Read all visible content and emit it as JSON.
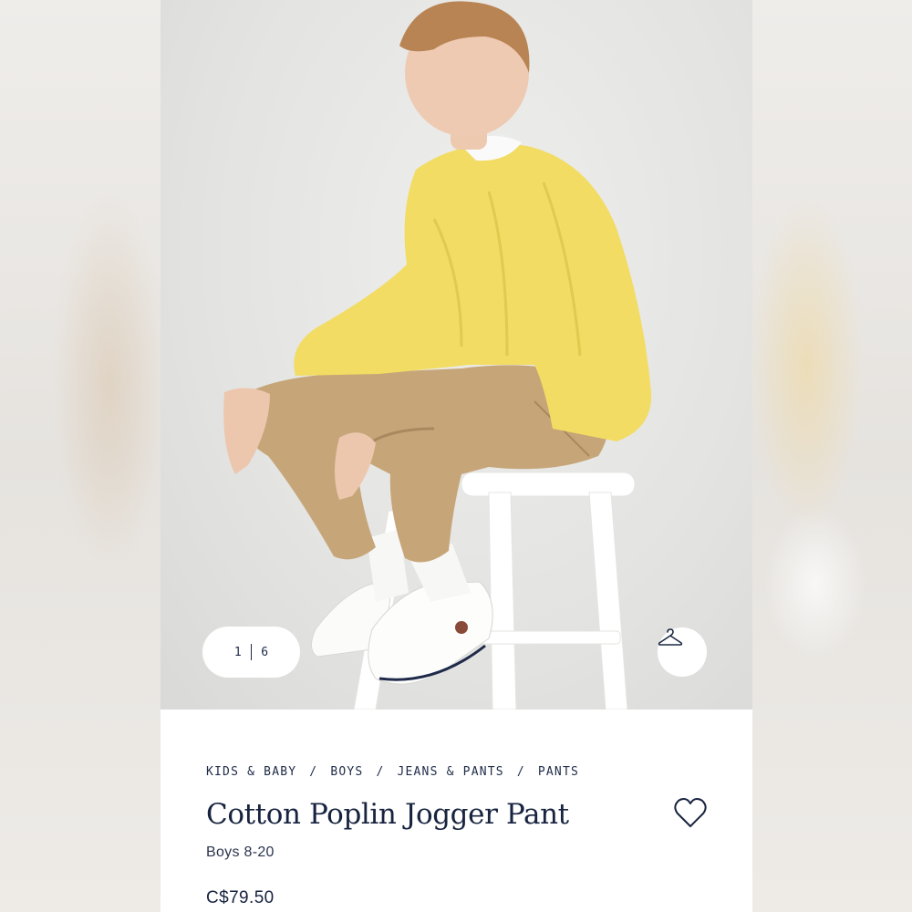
{
  "gallery": {
    "current": "1",
    "total": "6"
  },
  "breadcrumb": {
    "items": [
      "KIDS & BABY",
      "BOYS",
      "JEANS & PANTS",
      "PANTS"
    ],
    "separator": "/"
  },
  "product": {
    "title": "Cotton Poplin Jogger Pant",
    "subtitle": "Boys 8-20",
    "price": "C$79.50"
  },
  "icons": {
    "try_on": "hanger-icon",
    "wishlist": "heart-icon"
  },
  "colors": {
    "text_navy": "#17233f",
    "sweater": "#f2dc63",
    "pants": "#c4a477",
    "stool": "#ffffff"
  }
}
